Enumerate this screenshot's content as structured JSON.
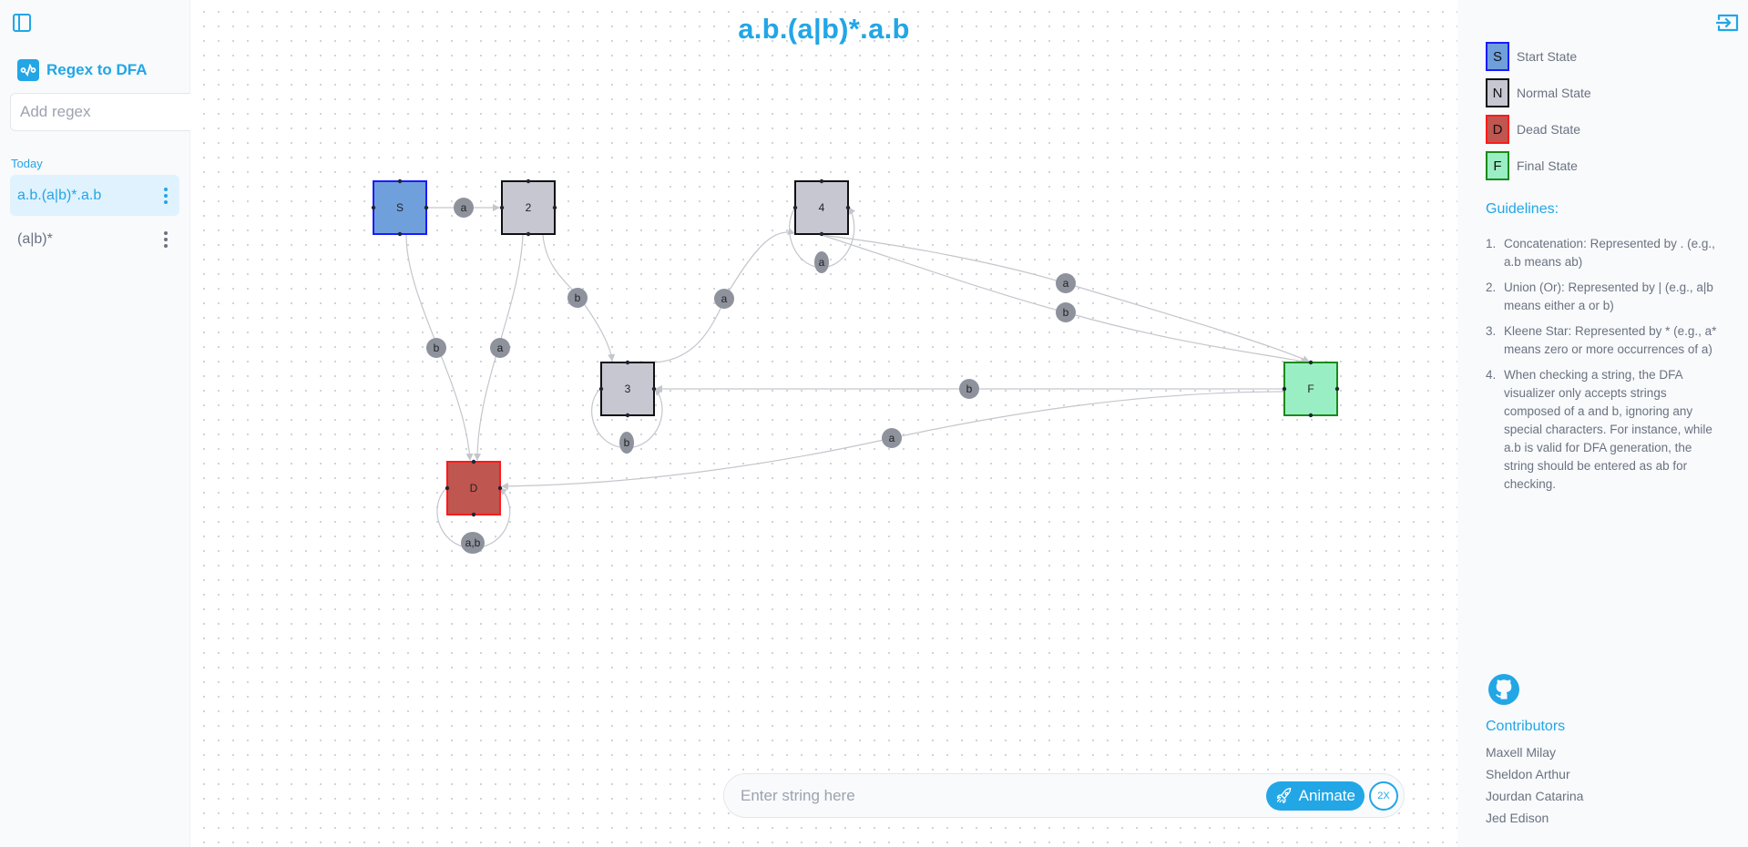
{
  "sidebar": {
    "toggle_icon": "panel-left-icon",
    "brand": {
      "name": "Regex to DFA",
      "icon": "regex-logo-icon"
    },
    "regex_input": {
      "placeholder": "Add regex",
      "value": ""
    },
    "submit_icon": "rocket-icon",
    "history_group": "Today",
    "history": [
      {
        "label": "a.b.(a|b)*.a.b",
        "active": true
      },
      {
        "label": "(a|b)*",
        "active": false
      }
    ]
  },
  "canvas": {
    "title": "a.b.(a|b)*.a.b",
    "nodes": [
      {
        "id": "S",
        "label": "S",
        "type": "start"
      },
      {
        "id": "2",
        "label": "2",
        "type": "normal"
      },
      {
        "id": "3",
        "label": "3",
        "type": "normal"
      },
      {
        "id": "4",
        "label": "4",
        "type": "normal"
      },
      {
        "id": "D",
        "label": "D",
        "type": "dead"
      },
      {
        "id": "F",
        "label": "F",
        "type": "final"
      }
    ],
    "edges": [
      {
        "from": "S",
        "to": "2",
        "label": "a"
      },
      {
        "from": "S",
        "to": "D",
        "label": "b"
      },
      {
        "from": "2",
        "to": "D",
        "label": "a"
      },
      {
        "from": "2",
        "to": "3",
        "label": "b"
      },
      {
        "from": "3",
        "to": "3",
        "label": "b"
      },
      {
        "from": "3",
        "to": "4",
        "label": "a"
      },
      {
        "from": "4",
        "to": "4",
        "label": "a"
      },
      {
        "from": "4",
        "to": "F",
        "label": "a"
      },
      {
        "from": "4",
        "to": "F",
        "label": "b"
      },
      {
        "from": "F",
        "to": "3",
        "label": "b"
      },
      {
        "from": "F",
        "to": "D",
        "label": "a"
      },
      {
        "from": "D",
        "to": "D",
        "label": "a,b"
      }
    ],
    "state_colors": {
      "start": {
        "fill": "#6fa0dc",
        "stroke": "#1a1aff"
      },
      "normal": {
        "fill": "#c6c7d0",
        "stroke": "#111111"
      },
      "dead": {
        "fill": "#bf5650",
        "stroke": "#ff1a1a"
      },
      "final": {
        "fill": "#9aeec4",
        "stroke": "#1a8a1a"
      }
    },
    "edge_label_color": "#8e929d"
  },
  "checker": {
    "placeholder": "Enter string here",
    "value": "",
    "animate_label": "Animate",
    "animate_icon": "rocket-icon",
    "speed_label": "2X"
  },
  "right_panel": {
    "exit_icon": "exit-panel-icon",
    "legend": [
      {
        "letter": "S",
        "label": "Start State",
        "fill": "#6fa0dc",
        "stroke": "#1a1aff"
      },
      {
        "letter": "N",
        "label": "Normal State",
        "fill": "#c6c7d0",
        "stroke": "#111111"
      },
      {
        "letter": "D",
        "label": "Dead State",
        "fill": "#bf5650",
        "stroke": "#ff1a1a"
      },
      {
        "letter": "F",
        "label": "Final State",
        "fill": "#9aeec4",
        "stroke": "#1a8a1a"
      }
    ],
    "guidelines_title": "Guidelines:",
    "guidelines": [
      {
        "num": "1.",
        "text": "Concatenation: Represented by . (e.g., a.b means ab)"
      },
      {
        "num": "2.",
        "text": "Union (Or): Represented by | (e.g., a|b means either a or b)"
      },
      {
        "num": "3.",
        "text": "Kleene Star: Represented by * (e.g., a* means zero or more occurrences of a)"
      },
      {
        "num": "4.",
        "text": "When checking a string, the DFA visualizer only accepts strings composed of a and b, ignoring any special characters. For instance, while a.b is valid for DFA generation, the string should be entered as ab for checking."
      }
    ],
    "github_icon": "github-icon",
    "contributors_title": "Contributors",
    "contributors": [
      "Maxell Milay",
      "Sheldon Arthur",
      "Jourdan Catarina",
      "Jed Edison"
    ]
  },
  "accent_color": "#22a6e6"
}
